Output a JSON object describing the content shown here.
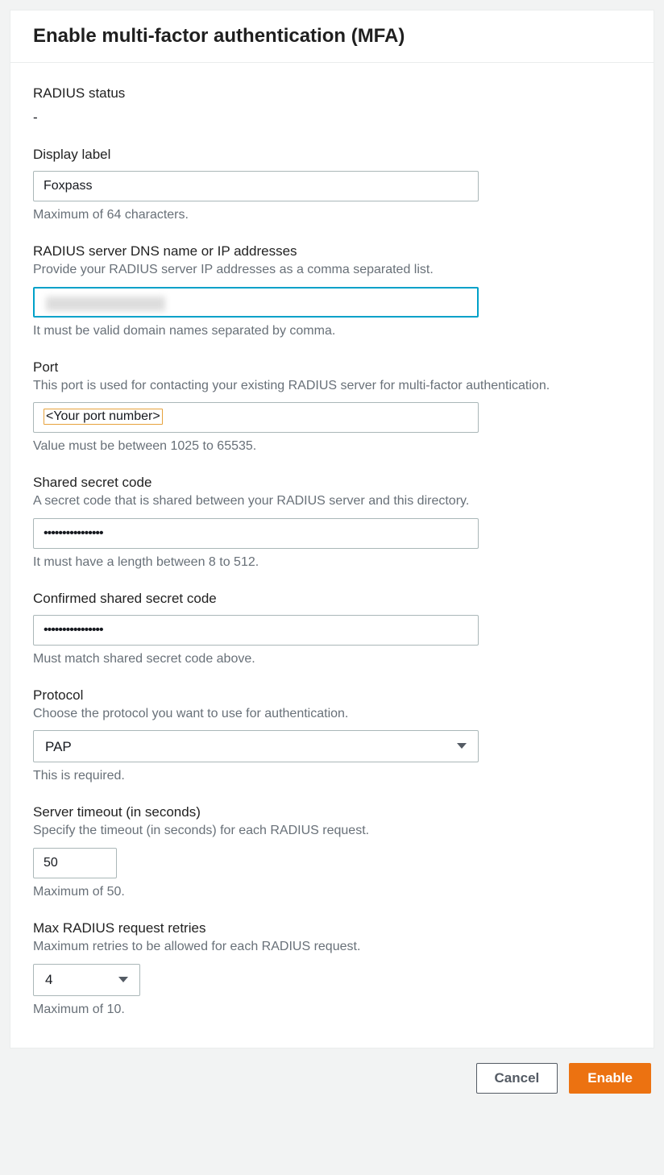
{
  "header": {
    "title": "Enable multi-factor authentication (MFA)"
  },
  "radius_status": {
    "label": "RADIUS status",
    "value": "-"
  },
  "display_label": {
    "label": "Display label",
    "value": "Foxpass",
    "help": "Maximum of 64 characters."
  },
  "dns": {
    "label": "RADIUS server DNS name or IP addresses",
    "desc": "Provide your RADIUS server IP addresses as a comma separated list.",
    "help": "It must be valid domain names separated by comma."
  },
  "port": {
    "label": "Port",
    "desc": "This port is used for contacting your existing RADIUS server for multi-factor authentication.",
    "value": "<Your port number>",
    "help": "Value must be between 1025 to 65535."
  },
  "secret": {
    "label": "Shared secret code",
    "desc": "A secret code that is shared between your RADIUS server and this directory.",
    "value": "••••••••••••••••",
    "help": "It must have a length between 8 to 512."
  },
  "secret_confirm": {
    "label": "Confirmed shared secret code",
    "value": "••••••••••••••••",
    "help": "Must match shared secret code above."
  },
  "protocol": {
    "label": "Protocol",
    "desc": "Choose the protocol you want to use for authentication.",
    "value": "PAP",
    "help": "This is required."
  },
  "timeout": {
    "label": "Server timeout (in seconds)",
    "desc": "Specify the timeout (in seconds) for each RADIUS request.",
    "value": "50",
    "help": "Maximum of 50."
  },
  "retries": {
    "label": "Max RADIUS request retries",
    "desc": "Maximum retries to be allowed for each RADIUS request.",
    "value": "4",
    "help": "Maximum of 10."
  },
  "footer": {
    "cancel": "Cancel",
    "enable": "Enable"
  }
}
